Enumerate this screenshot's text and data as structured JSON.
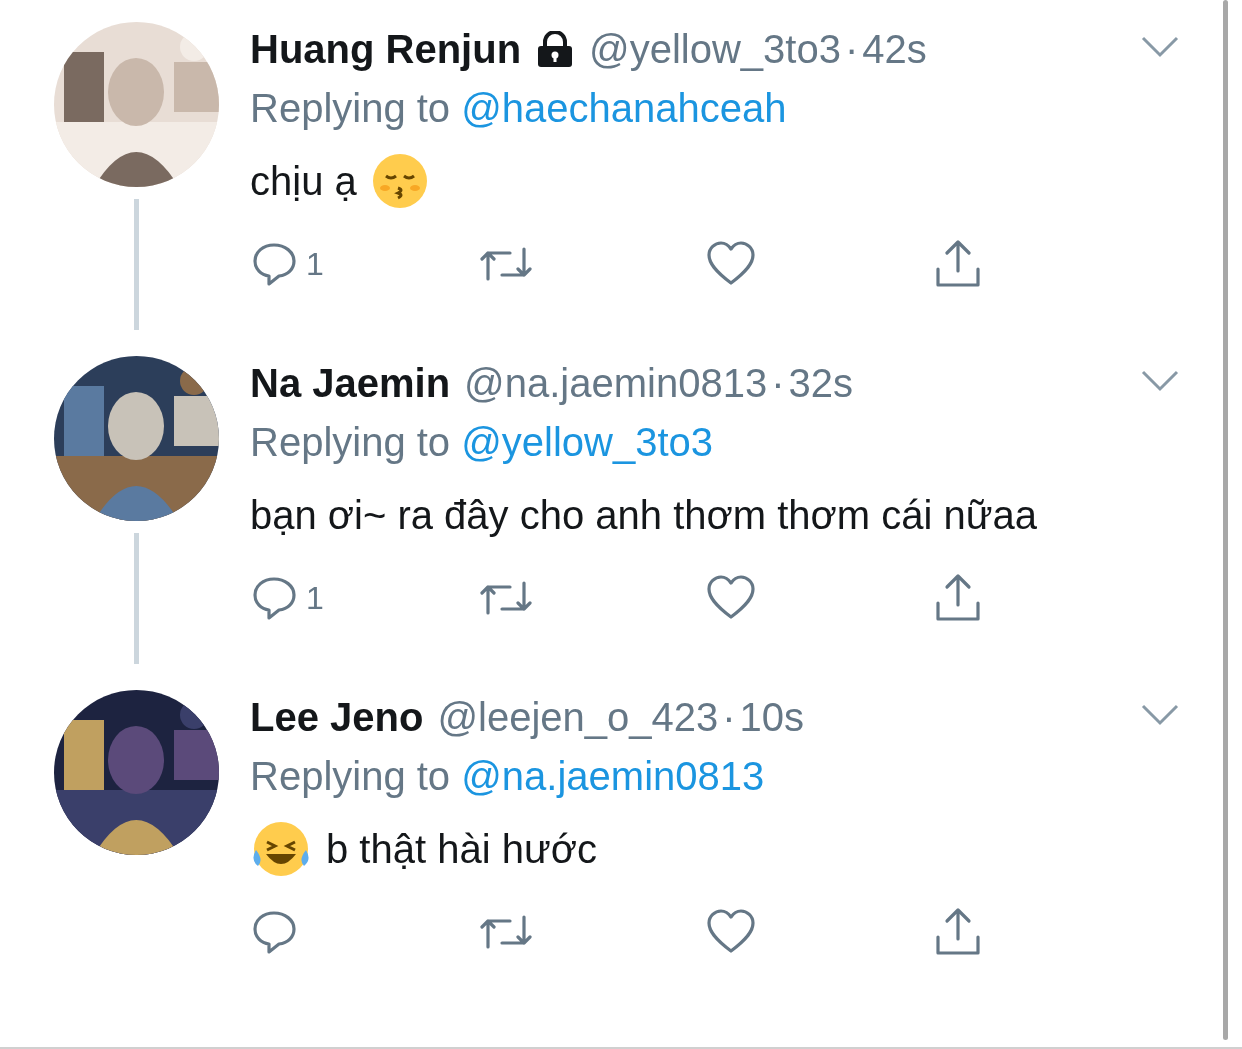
{
  "tweets": [
    {
      "name": "Huang Renjun",
      "locked": true,
      "handle": "@yellow_3to3",
      "separator": "·",
      "time": "42s",
      "replying_label": "Replying to",
      "replying_to": "@haechanahceah",
      "body": [
        {
          "kind": "text",
          "text": "chịu ạ"
        },
        {
          "kind": "kiss"
        }
      ],
      "reply_count": "1",
      "thread_line": true
    },
    {
      "name": "Na Jaemin",
      "locked": false,
      "handle": "@na.jaemin0813",
      "separator": "·",
      "time": "32s",
      "replying_label": "Replying to",
      "replying_to": "@yellow_3to3",
      "body": [
        {
          "kind": "text",
          "text": "bạn ơi~ ra đây cho anh thơm thơm cái nữaa"
        }
      ],
      "reply_count": "1",
      "thread_line": true
    },
    {
      "name": "Lee Jeno",
      "locked": false,
      "handle": "@leejen_o_423",
      "separator": "·",
      "time": "10s",
      "replying_label": "Replying to",
      "replying_to": "@na.jaemin0813",
      "body": [
        {
          "kind": "laugh"
        },
        {
          "kind": "text",
          "text": "b thật hài hước"
        }
      ],
      "thread_line": false
    }
  ]
}
